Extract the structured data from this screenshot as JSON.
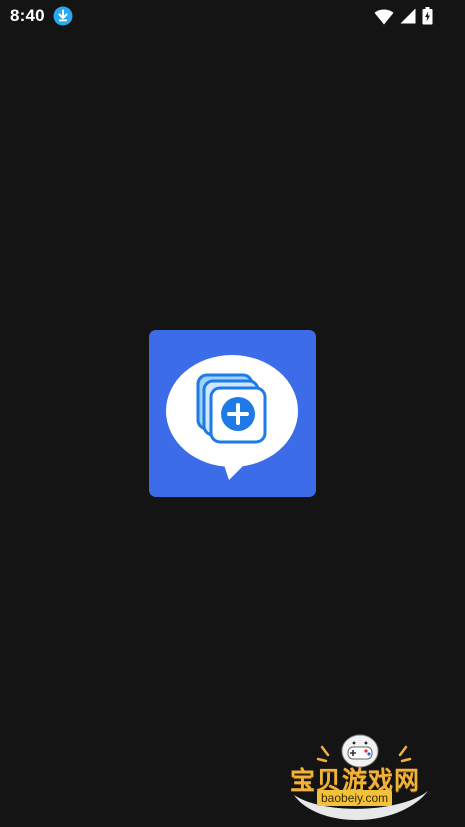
{
  "status_bar": {
    "time": "8:40",
    "icons": [
      "download-icon",
      "wifi-icon",
      "cellular-signal-icon",
      "battery-charging-icon"
    ]
  },
  "splash": {
    "logo_icon": "chat-bubble-add-pages-icon",
    "colors": {
      "background": "#141414",
      "logo_background": "#3c6ce8",
      "bubble": "#ffffff",
      "accent": "#1e7ae6"
    }
  },
  "watermark": {
    "title": "宝贝游戏网",
    "domain": "baobeiy.com",
    "icon": "gamepad-icon"
  }
}
